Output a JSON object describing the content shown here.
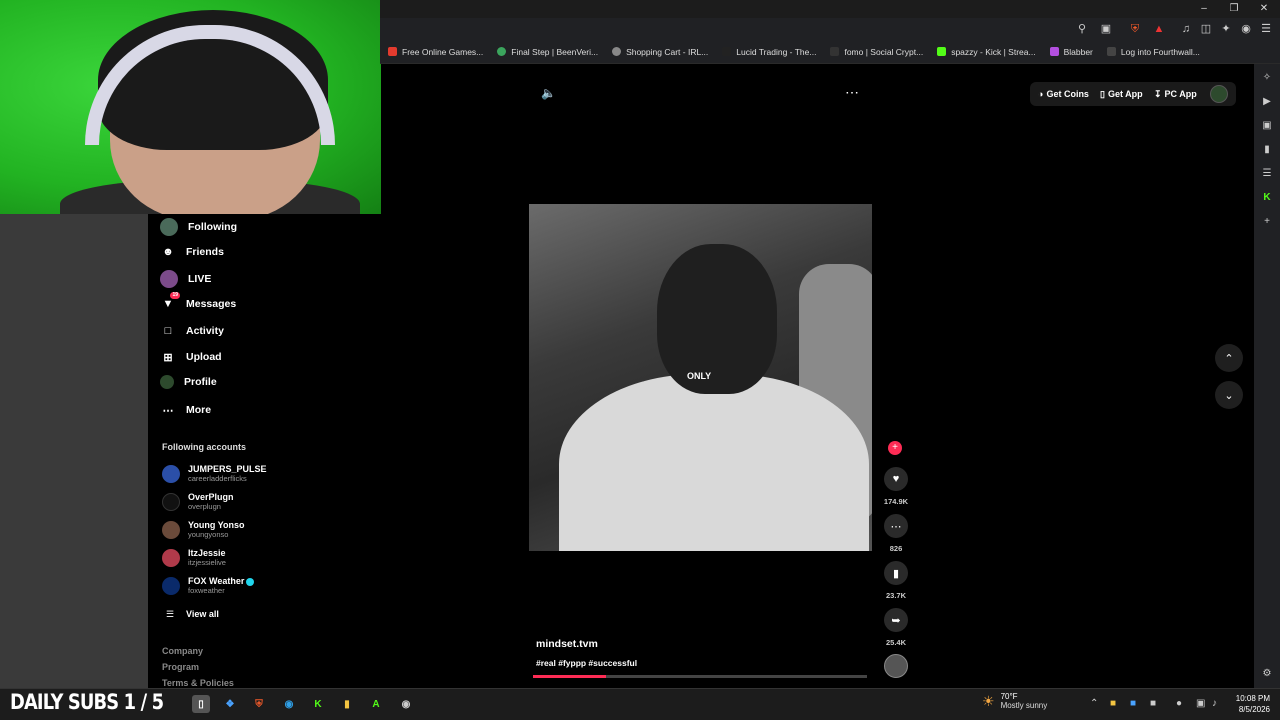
{
  "bookmarks": [
    {
      "label": "Free Online Games...",
      "color": "#e33b2e"
    },
    {
      "label": "Final Step | BeenVeri...",
      "color": "#3ba55d"
    },
    {
      "label": "Shopping Cart - IRL...",
      "color": "#888888"
    },
    {
      "label": "Lucid Trading - The...",
      "color": "#222222"
    },
    {
      "label": "fomo | Social Crypt...",
      "color": "#333333"
    },
    {
      "label": "spazzy - Kick | Strea...",
      "color": "#53fc18"
    },
    {
      "label": "Blabber",
      "color": "#b34fe0"
    },
    {
      "label": "Log into Fourthwall...",
      "color": "#444444"
    }
  ],
  "sidebar": {
    "items": [
      {
        "label": "Following",
        "icon": "following-avatar-icon"
      },
      {
        "label": "Friends",
        "icon": "friends-icon"
      },
      {
        "label": "LIVE",
        "icon": "live-avatar-icon"
      },
      {
        "label": "Messages",
        "icon": "messages-icon",
        "badge": "19"
      },
      {
        "label": "Activity",
        "icon": "activity-icon"
      },
      {
        "label": "Upload",
        "icon": "upload-icon"
      },
      {
        "label": "Profile",
        "icon": "profile-avatar-icon"
      },
      {
        "label": "More",
        "icon": "more-icon"
      }
    ],
    "following_title": "Following accounts",
    "accounts": [
      {
        "name": "JUMPERS_PULSE",
        "handle": "careerladderflicks",
        "color": "#2b4fa8"
      },
      {
        "name": "OverPlugn",
        "handle": "overplugn",
        "color": "#111111"
      },
      {
        "name": "Young Yonso",
        "handle": "youngyonso",
        "color": "#6a4a3a"
      },
      {
        "name": "ItzJessie",
        "handle": "itzjessielive",
        "color": "#b03a4a"
      },
      {
        "name": "FOX Weather",
        "handle": "foxweather",
        "color": "#0a2a6a",
        "verified": true
      }
    ],
    "view_all": "View all",
    "footer": [
      "Company",
      "Program",
      "Terms & Policies"
    ]
  },
  "video": {
    "caption": "ONLY",
    "author": "mindset.tvm",
    "tags": "#real #fyppp #successful",
    "progress": 0.22
  },
  "actions": {
    "likes": "174.9K",
    "comments": "826",
    "saves": "23.7K",
    "shares": "25.4K"
  },
  "topbar": {
    "get_coins": "Get Coins",
    "get_app": "Get App",
    "pc_app": "PC App"
  },
  "taskbar": {
    "overlay_text": "DAILY SUBS 1 / 5",
    "temp": "70°F",
    "weather": "Mostly sunny",
    "time": "10:08 PM",
    "date": "8/5/2026"
  },
  "colors": {
    "accent": "#fe2c55",
    "verified": "#20d5ec"
  }
}
